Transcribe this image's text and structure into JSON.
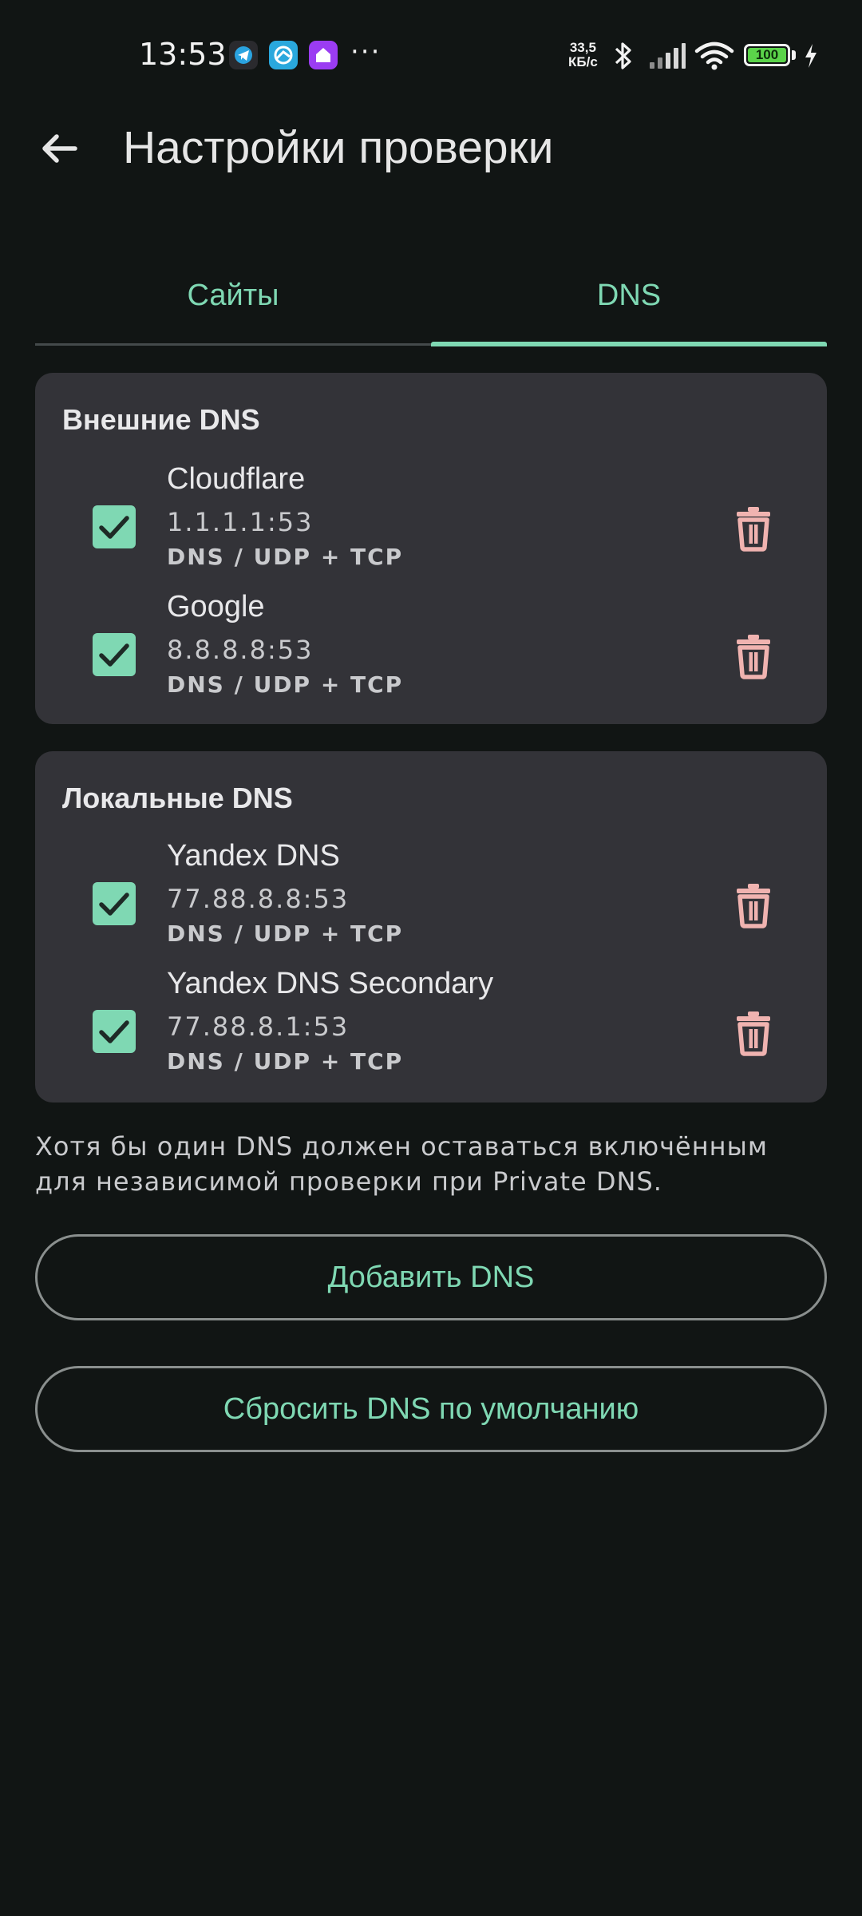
{
  "status_bar": {
    "time": "13:53",
    "net_speed_value": "33,5",
    "net_speed_unit": "КБ/с",
    "battery_level": "100",
    "icons": [
      "telegram-icon",
      "vpn-icon",
      "home-icon",
      "more-dots-icon",
      "bluetooth-icon",
      "signal-icon",
      "wifi-icon",
      "battery-icon",
      "charging-icon"
    ],
    "more_dots": "···"
  },
  "app_bar": {
    "back_icon": "arrow-left-icon",
    "title": "Настройки проверки"
  },
  "tabs": [
    {
      "label": "Сайты",
      "selected": false
    },
    {
      "label": "DNS",
      "selected": true
    }
  ],
  "sections": [
    {
      "title": "Внешние DNS",
      "items": [
        {
          "name": "Cloudflare",
          "address": "1.1.1.1:53",
          "protocol": "DNS / UDP + TCP",
          "checked": true
        },
        {
          "name": "Google",
          "address": "8.8.8.8:53",
          "protocol": "DNS / UDP + TCP",
          "checked": true
        }
      ]
    },
    {
      "title": "Локальные DNS",
      "items": [
        {
          "name": "Yandex DNS",
          "address": "77.88.8.8:53",
          "protocol": "DNS / UDP + TCP",
          "checked": true
        },
        {
          "name": "Yandex DNS Secondary",
          "address": "77.88.8.1:53",
          "protocol": "DNS / UDP + TCP",
          "checked": true
        }
      ]
    }
  ],
  "hint": "Хотя бы один DNS должен оставаться включённым для независимой проверки при Private DNS.",
  "buttons": {
    "add_dns": "Добавить DNS",
    "reset_dns": "Сбросить DNS по умолчанию"
  },
  "colors": {
    "background": "#111514",
    "card": "#333338",
    "accent": "#7fd8b3",
    "delete": "#f0b3b0",
    "text_primary": "#e8e8ea",
    "text_secondary": "#c9cacd"
  }
}
